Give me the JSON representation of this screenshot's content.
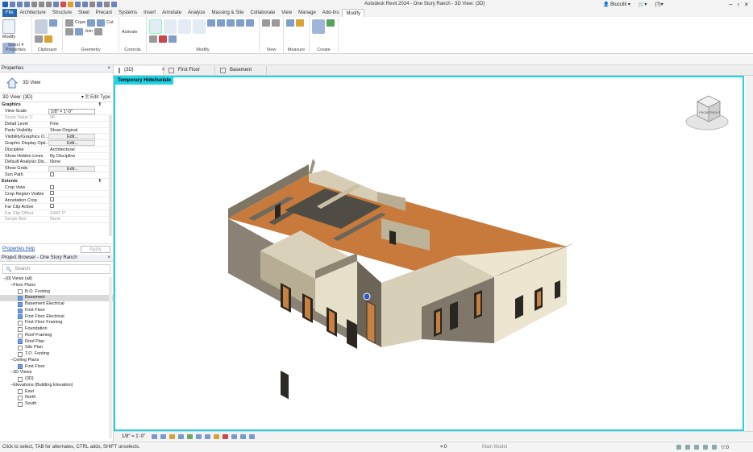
{
  "app_title": "Autodesk Revit 2024 - One Story Ranch - 3D View: {3D}",
  "user": {
    "name": "Bluccilli",
    "help": "?"
  },
  "ribbon_tabs": [
    "File",
    "Architecture",
    "Structure",
    "Steel",
    "Precast",
    "Systems",
    "Insert",
    "Annotate",
    "Analyze",
    "Massing & Site",
    "Collaborate",
    "View",
    "Manage",
    "Add-Ins",
    "Modify"
  ],
  "active_ribbon_tab": "Modify",
  "ribbon": {
    "select_label": "Select",
    "properties_label": "Properties",
    "modify_label": "Modify",
    "panels": [
      "Clipboard",
      "Geometry",
      "Controls",
      "Modify",
      "View",
      "Measure",
      "Create"
    ],
    "cope": "Cope",
    "cut": "Cut",
    "join": "Join",
    "paste": "Paste",
    "activate": "Activate"
  },
  "properties": {
    "title": "Properties",
    "type_name": "3D View",
    "selector": "3D View: {3D}",
    "edit_type": "Edit Type",
    "sections": [
      {
        "name": "Graphics",
        "rows": [
          {
            "k": "View Scale",
            "v": "1/8\" = 1'-0\"",
            "style": "box"
          },
          {
            "k": "Scale Value    1:",
            "v": "96",
            "style": "grey"
          },
          {
            "k": "Detail Level",
            "v": "Fine"
          },
          {
            "k": "Parts Visibility",
            "v": "Show Original"
          },
          {
            "k": "Visibility/Graphics O...",
            "v": "Edit...",
            "style": "btn"
          },
          {
            "k": "Graphic Display Opti...",
            "v": "Edit...",
            "style": "btn"
          },
          {
            "k": "Discipline",
            "v": "Architectural"
          },
          {
            "k": "Show Hidden Lines",
            "v": "By Discipline"
          },
          {
            "k": "Default Analysis Dis...",
            "v": "None"
          },
          {
            "k": "Show Grids",
            "v": "Edit...",
            "style": "btn"
          },
          {
            "k": "Sun Path",
            "v": "",
            "style": "check"
          }
        ]
      },
      {
        "name": "Extents",
        "rows": [
          {
            "k": "Crop View",
            "v": "",
            "style": "check"
          },
          {
            "k": "Crop Region Visible",
            "v": "",
            "style": "check"
          },
          {
            "k": "Annotation Crop",
            "v": "",
            "style": "check"
          },
          {
            "k": "Far Clip Active",
            "v": "",
            "style": "check"
          },
          {
            "k": "Far Clip Offset",
            "v": "1000' 0\"",
            "style": "grey"
          },
          {
            "k": "Scope Box",
            "v": "None",
            "style": "grey"
          }
        ]
      }
    ],
    "help_link": "Properties help",
    "apply": "Apply"
  },
  "browser": {
    "title": "Project Browser - One Story Ranch",
    "search_placeholder": "Search",
    "nodes": [
      {
        "label": "[0] Views (all)",
        "depth": 0,
        "type": "expander"
      },
      {
        "label": "Floor Plans",
        "depth": 1,
        "type": "expander"
      },
      {
        "label": "B.O. Footing",
        "depth": 2,
        "type": "view"
      },
      {
        "label": "Basement",
        "depth": 2,
        "type": "viewb",
        "selected": true
      },
      {
        "label": "Basement Electrical",
        "depth": 2,
        "type": "viewb"
      },
      {
        "label": "First Floor",
        "depth": 2,
        "type": "viewb"
      },
      {
        "label": "First Floor Electrical",
        "depth": 2,
        "type": "viewb"
      },
      {
        "label": "First Floor Framing",
        "depth": 2,
        "type": "view"
      },
      {
        "label": "Foundation",
        "depth": 2,
        "type": "view"
      },
      {
        "label": "Roof Framing",
        "depth": 2,
        "type": "view"
      },
      {
        "label": "Roof Plan",
        "depth": 2,
        "type": "viewb"
      },
      {
        "label": "Site Plan",
        "depth": 2,
        "type": "view"
      },
      {
        "label": "T.O. Footing",
        "depth": 2,
        "type": "view"
      },
      {
        "label": "Ceiling Plans",
        "depth": 1,
        "type": "expander"
      },
      {
        "label": "First Floor",
        "depth": 2,
        "type": "viewb"
      },
      {
        "label": "3D Views",
        "depth": 1,
        "type": "expander"
      },
      {
        "label": "{3D}",
        "depth": 2,
        "type": "view"
      },
      {
        "label": "Elevations (Building Elevation)",
        "depth": 1,
        "type": "expander"
      },
      {
        "label": "East",
        "depth": 2,
        "type": "view"
      },
      {
        "label": "North",
        "depth": 2,
        "type": "view"
      },
      {
        "label": "South",
        "depth": 2,
        "type": "view"
      }
    ]
  },
  "view_tabs": [
    {
      "label": "{3D}",
      "active": true
    },
    {
      "label": "First Floor",
      "active": false
    },
    {
      "label": "Basement",
      "active": false
    }
  ],
  "viewport": {
    "banner": "Temporary Hide/Isolate",
    "viewcube": {
      "front": "FRONT",
      "right": "RIGHT"
    },
    "accent": "#22d3e6"
  },
  "view_control_bar": {
    "scale": "1/8\" = 1'-0\""
  },
  "status": {
    "text": "Click to select, TAB for alternates, CTRL adds, SHIFT unselects.",
    "selection_count": ":0",
    "main_model": "Main Model",
    "filter": ":0"
  }
}
